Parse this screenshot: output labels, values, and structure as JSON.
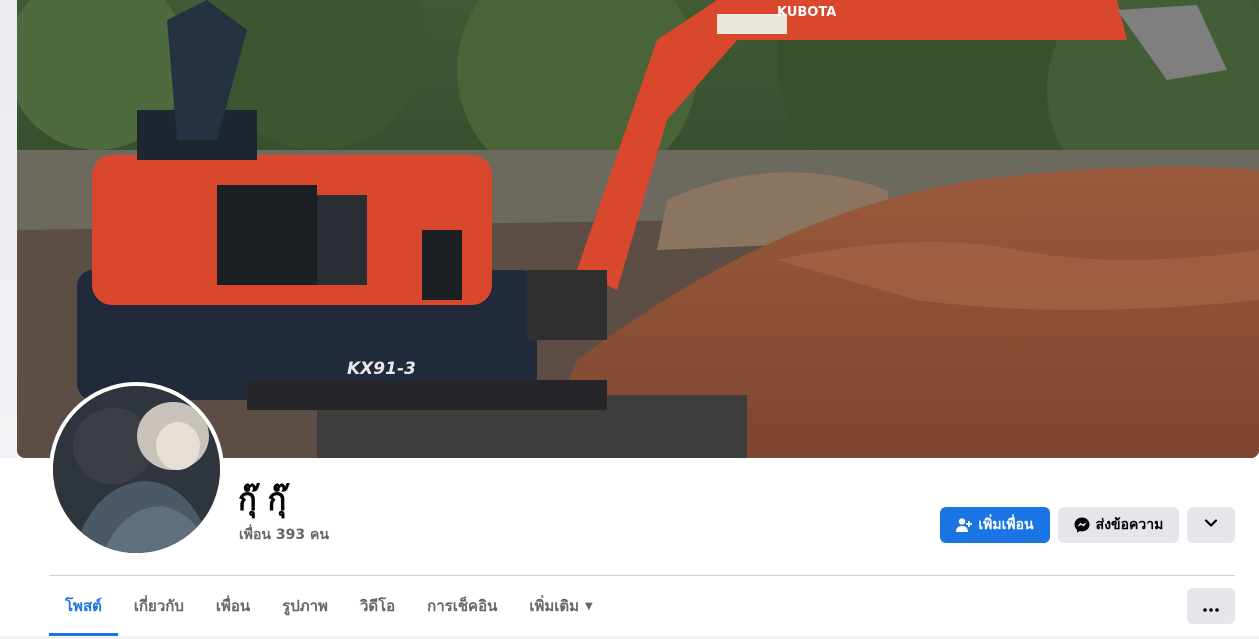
{
  "profile": {
    "name": "กุ๊ กุ๊",
    "friends_count": "เพื่อน 393 คน"
  },
  "actions": {
    "add_friend": "เพิ่มเพื่อน",
    "message": "ส่งข้อความ"
  },
  "tabs": [
    {
      "label": "โพสต์"
    },
    {
      "label": "เกี่ยวกับ"
    },
    {
      "label": "เพื่อน"
    },
    {
      "label": "รูปภาพ"
    },
    {
      "label": "วิดีโอ"
    },
    {
      "label": "การเช็คอิน"
    },
    {
      "label": "เพิ่มเติม"
    }
  ],
  "cover": {
    "brand_text": "KUBOTA",
    "model_text": "KX91-3"
  },
  "colors": {
    "primary": "#1b74e4",
    "secondary_button": "#e4e6eb",
    "muted_text": "#65676b"
  }
}
